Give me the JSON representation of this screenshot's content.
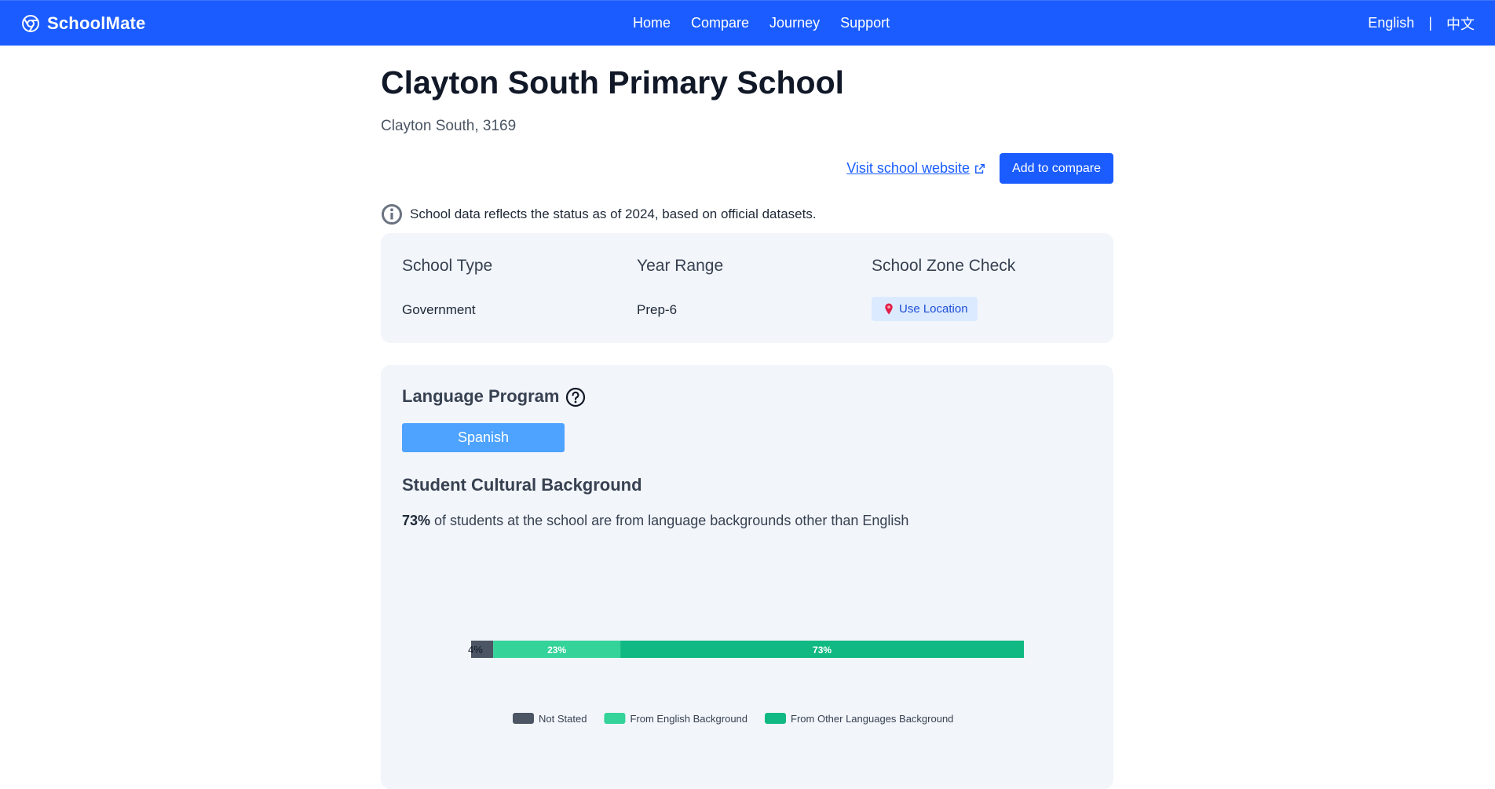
{
  "nav": {
    "brand": "SchoolMate",
    "links": [
      "Home",
      "Compare",
      "Journey",
      "Support"
    ],
    "lang_en": "English",
    "lang_sep": "|",
    "lang_zh": "中文"
  },
  "school": {
    "name": "Clayton South Primary School",
    "location": "Clayton South, 3169",
    "website_label": "Visit school website",
    "compare_label": "Add to compare"
  },
  "notice": "School data reflects the status as of 2024, based on official datasets.",
  "info": {
    "type_label": "School Type",
    "type_value": "Government",
    "range_label": "Year Range",
    "range_value": "Prep-6",
    "zone_label": "School Zone Check",
    "zone_button": "Use Location"
  },
  "language": {
    "title": "Language Program",
    "programs": [
      "Spanish"
    ]
  },
  "culture": {
    "title": "Student Cultural Background",
    "stat_value": "73%",
    "stat_text": " of students at the school are from language backgrounds other than English"
  },
  "colors": {
    "primary": "#1a5cff",
    "not_stated": "#4b5563",
    "english": "#34d399",
    "other": "#10b981"
  },
  "chart_data": {
    "type": "bar",
    "orientation": "horizontal-stacked",
    "categories": [
      ""
    ],
    "series": [
      {
        "name": "Not Stated",
        "values": [
          4
        ],
        "label": "4%",
        "color": "#4b5563"
      },
      {
        "name": "From English Background",
        "values": [
          23
        ],
        "label": "23%",
        "color": "#34d399"
      },
      {
        "name": "From Other Languages Background",
        "values": [
          73
        ],
        "label": "73%",
        "color": "#10b981"
      }
    ],
    "xlim": [
      0,
      100
    ],
    "legend_position": "bottom"
  }
}
